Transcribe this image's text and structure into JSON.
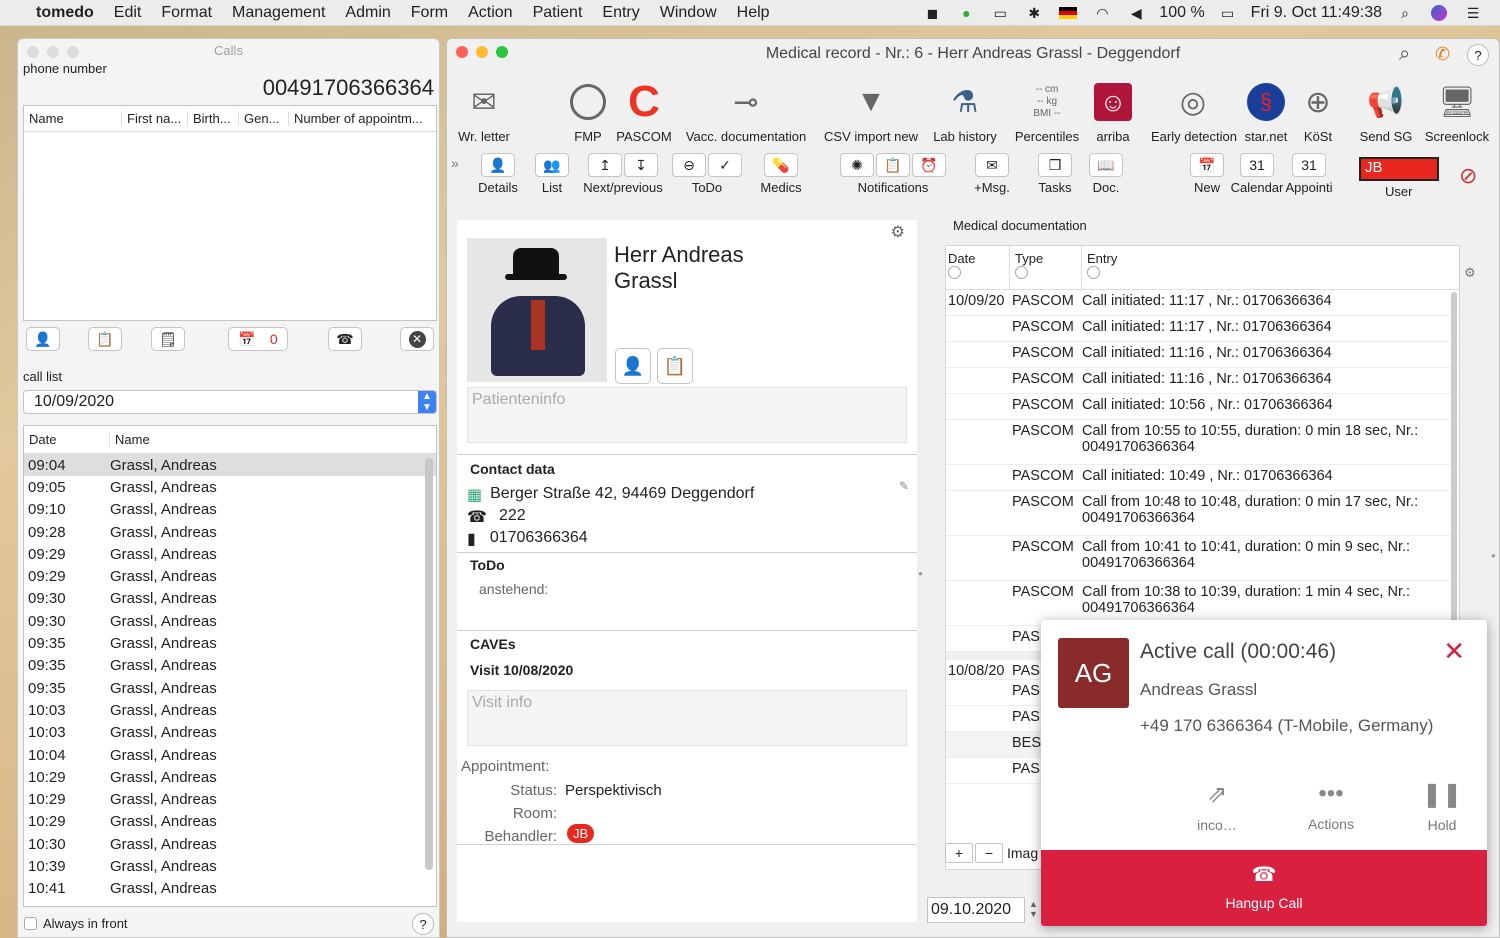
{
  "menubar": {
    "app": "tomedo",
    "items": [
      "Edit",
      "Format",
      "Management",
      "Admin",
      "Form",
      "Action",
      "Patient",
      "Entry",
      "Window",
      "Help"
    ],
    "battery": "100 %",
    "clock": "Fri 9. Oct  11:49:38"
  },
  "calls": {
    "title": "Calls",
    "phone_label": "phone number",
    "phone_number": "00491706366364",
    "columns": [
      "Name",
      "First na...",
      "Birth...",
      "Gen...",
      "Number of appointm..."
    ],
    "badge_count": "0",
    "call_list_label": "call list",
    "date": "10/09/2020",
    "list_headers": [
      "Date",
      "Name"
    ],
    "rows": [
      {
        "t": "09:04",
        "n": "Grassl, Andreas"
      },
      {
        "t": "09:05",
        "n": "Grassl, Andreas"
      },
      {
        "t": "09:10",
        "n": "Grassl, Andreas"
      },
      {
        "t": "09:28",
        "n": "Grassl, Andreas"
      },
      {
        "t": "09:29",
        "n": "Grassl, Andreas"
      },
      {
        "t": "09:29",
        "n": "Grassl, Andreas"
      },
      {
        "t": "09:30",
        "n": "Grassl, Andreas"
      },
      {
        "t": "09:30",
        "n": "Grassl, Andreas"
      },
      {
        "t": "09:35",
        "n": "Grassl, Andreas"
      },
      {
        "t": "09:35",
        "n": "Grassl, Andreas"
      },
      {
        "t": "09:35",
        "n": "Grassl, Andreas"
      },
      {
        "t": "10:03",
        "n": "Grassl, Andreas"
      },
      {
        "t": "10:03",
        "n": "Grassl, Andreas"
      },
      {
        "t": "10:04",
        "n": "Grassl, Andreas"
      },
      {
        "t": "10:29",
        "n": "Grassl, Andreas"
      },
      {
        "t": "10:29",
        "n": "Grassl, Andreas"
      },
      {
        "t": "10:29",
        "n": "Grassl, Andreas"
      },
      {
        "t": "10:30",
        "n": "Grassl, Andreas"
      },
      {
        "t": "10:39",
        "n": "Grassl, Andreas"
      },
      {
        "t": "10:41",
        "n": "Grassl, Andreas"
      }
    ],
    "always_front": "Always in front",
    "help": "?"
  },
  "record": {
    "title": "Medical record - Nr.: 6 - Herr Andreas Grassl - Deggendorf",
    "toolbar1": [
      "Wr. letter",
      "FMP",
      "PASCOM",
      "Vacc. documentation",
      "CSV import new",
      "Lab history",
      "Percentiles",
      "arriba",
      "Early detection",
      "star.net",
      "KöSt",
      "Send SG",
      "Screenlock"
    ],
    "percentiles_text": "-- cm\n-- kg\nBMI --",
    "toolbar2": [
      "Details",
      "List",
      "Next/previous",
      "ToDo",
      "Medics",
      "Notifications",
      "+Msg.",
      "Tasks",
      "Doc.",
      "New",
      "Calendar",
      "Appointi",
      "User"
    ],
    "user": "JB",
    "patient": {
      "salutation": "Herr Andreas",
      "surname": "Grassl",
      "info_placeholder": "Patienteninfo",
      "contact_title": "Contact data",
      "address": "Berger Straße 42, 94469 Deggendorf",
      "phone": "222",
      "mobile": "01706366364",
      "todo_title": "ToDo",
      "todo_pending": "anstehend:",
      "caves": "CAVEs",
      "visit": "Visit 10/08/2020",
      "visit_placeholder": "Visit info",
      "appointment": "Appointment:",
      "status_lbl": "Status:",
      "status_val": "Perspektivisch",
      "room_lbl": "Room:",
      "behandler_lbl": "Behandler:",
      "behandler_val": "JB"
    },
    "meddoc": {
      "title": "Medical documentation",
      "headers": [
        "Date",
        "Type",
        "Entry"
      ],
      "rows": [
        {
          "d": "10/09/20",
          "ty": "PASCOM",
          "e": "Call initiated: 11:17 , Nr.: 01706366364"
        },
        {
          "d": "",
          "ty": "PASCOM",
          "e": "Call initiated: 11:17 , Nr.: 01706366364"
        },
        {
          "d": "",
          "ty": "PASCOM",
          "e": "Call initiated: 11:16 , Nr.: 01706366364"
        },
        {
          "d": "",
          "ty": "PASCOM",
          "e": "Call initiated: 11:16 , Nr.: 01706366364"
        },
        {
          "d": "",
          "ty": "PASCOM",
          "e": "Call initiated: 10:56 , Nr.: 01706366364"
        },
        {
          "d": "",
          "ty": "PASCOM",
          "e": "Call from 10:55 to 10:55, duration: 0 min 18 sec, Nr.: 00491706366364"
        },
        {
          "d": "",
          "ty": "PASCOM",
          "e": "Call initiated: 10:49 , Nr.: 01706366364"
        },
        {
          "d": "",
          "ty": "PASCOM",
          "e": "Call from 10:48 to 10:48, duration: 0 min 17 sec, Nr.: 00491706366364"
        },
        {
          "d": "",
          "ty": "PASCOM",
          "e": "Call from 10:41 to 10:41, duration: 0 min 9 sec, Nr.: 00491706366364"
        },
        {
          "d": "",
          "ty": "PASCOM",
          "e": "Call from 10:38 to 10:39, duration: 1 min 4 sec, Nr.: 00491706366364"
        },
        {
          "d": "",
          "ty": "PAS",
          "e": ""
        },
        {
          "d": "10/08/20",
          "ty": "PAS",
          "e": ""
        },
        {
          "d": "",
          "ty": "PAS",
          "e": ""
        },
        {
          "d": "",
          "ty": "PAS",
          "e": ""
        },
        {
          "d": "",
          "ty": "BES",
          "e": ""
        },
        {
          "d": "",
          "ty": "PAS",
          "e": ""
        }
      ],
      "footer_text": "Imag",
      "date_field": "09.10.2020"
    }
  },
  "callcard": {
    "initials": "AG",
    "title": "Active call (00:00:46)",
    "name": "Andreas Grassl",
    "number": "+49 170 6366364 (T-Mobile, Germany)",
    "btn_transfer": "inco…",
    "btn_actions": "Actions",
    "btn_hold": "Hold",
    "hangup": "Hangup Call"
  }
}
